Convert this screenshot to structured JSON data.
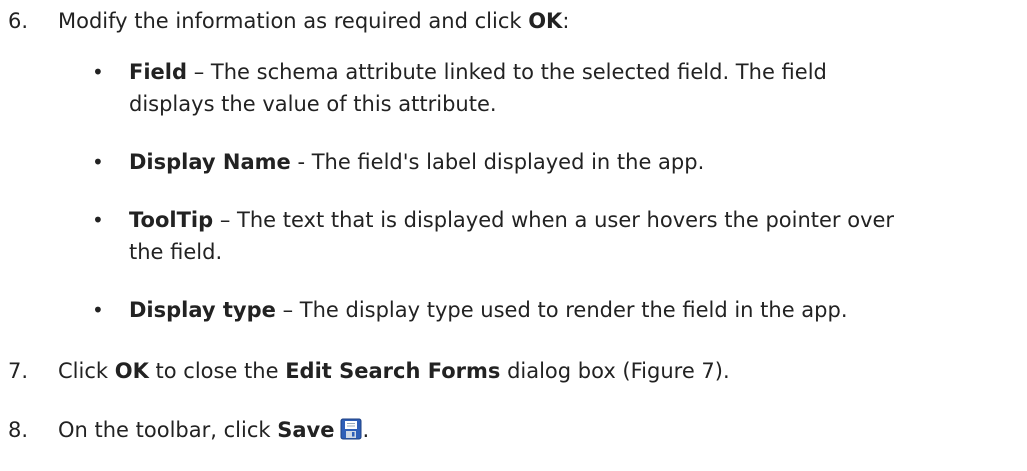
{
  "steps": [
    {
      "number": "6.",
      "text_before": "Modify the information as required and click ",
      "bold1": "OK",
      "text_after": ":"
    },
    {
      "number": "7.",
      "text_before": "Click ",
      "bold1": "OK",
      "text_mid": " to close the ",
      "bold2": "Edit Search Forms",
      "text_after": " dialog box (Figure 7)."
    },
    {
      "number": "8.",
      "text_before": "On the toolbar, click ",
      "bold1": "Save",
      "text_after": ".",
      "icon": "save-icon"
    }
  ],
  "bullets": [
    {
      "marker": "•",
      "term": "Field",
      "separator": " – ",
      "line1": "The schema attribute linked to the selected field. The field",
      "line2": "displays the value of this attribute."
    },
    {
      "marker": "•",
      "term": "Display Name",
      "separator": " - ",
      "line1": "The field's label displayed in the app.",
      "line2": ""
    },
    {
      "marker": "•",
      "term": "ToolTip",
      "separator": " – ",
      "line1": "The text that is displayed when a user hovers the pointer over",
      "line2": "the field."
    },
    {
      "marker": "•",
      "term": "Display type",
      "separator": " – ",
      "line1": "The display type used to render the field in the app.",
      "line2": ""
    }
  ]
}
